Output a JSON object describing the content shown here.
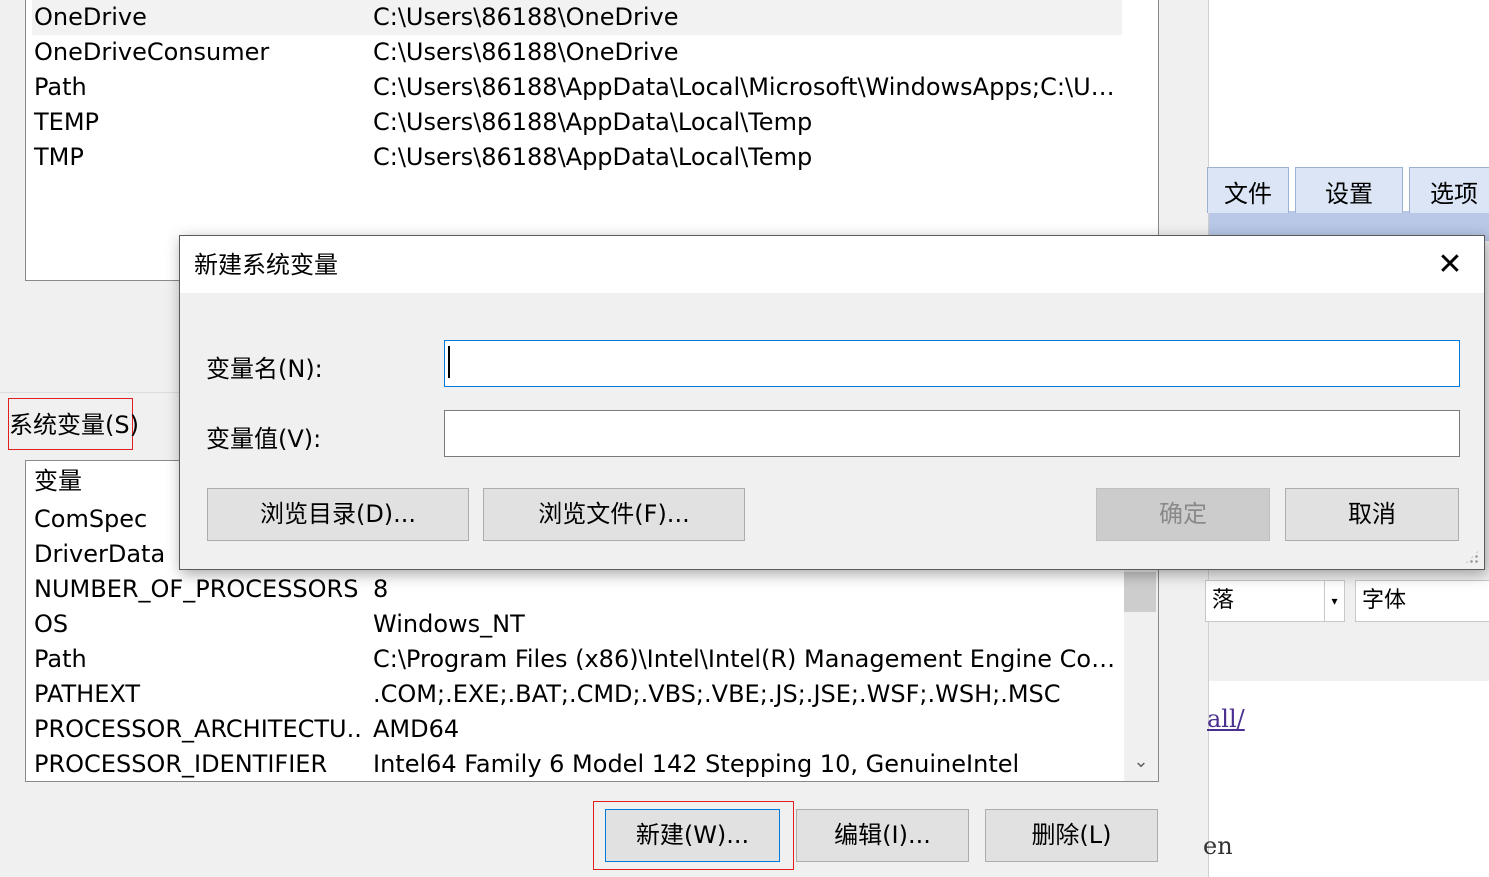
{
  "user_vars": {
    "rows": [
      {
        "name": "OneDrive",
        "value": "C:\\Users\\86188\\OneDrive"
      },
      {
        "name": "OneDriveConsumer",
        "value": "C:\\Users\\86188\\OneDrive"
      },
      {
        "name": "Path",
        "value": "C:\\Users\\86188\\AppData\\Local\\Microsoft\\WindowsApps;C:\\Use..."
      },
      {
        "name": "TEMP",
        "value": "C:\\Users\\86188\\AppData\\Local\\Temp"
      },
      {
        "name": "TMP",
        "value": "C:\\Users\\86188\\AppData\\Local\\Temp"
      }
    ]
  },
  "system_vars": {
    "group_label": "系统变量(S)",
    "column_header": "变量",
    "rows": [
      {
        "name": "ComSpec",
        "value": ""
      },
      {
        "name": "DriverData",
        "value": ""
      },
      {
        "name": "NUMBER_OF_PROCESSORS",
        "value": "8"
      },
      {
        "name": "OS",
        "value": "Windows_NT"
      },
      {
        "name": "Path",
        "value": "C:\\Program Files (x86)\\Intel\\Intel(R) Management Engine Comp..."
      },
      {
        "name": "PATHEXT",
        "value": ".COM;.EXE;.BAT;.CMD;.VBS;.VBE;.JS;.JSE;.WSF;.WSH;.MSC"
      },
      {
        "name": "PROCESSOR_ARCHITECTU...",
        "value": "AMD64"
      },
      {
        "name": "PROCESSOR_IDENTIFIER",
        "value": "Intel64 Family 6 Model 142 Stepping 10, GenuineIntel"
      }
    ],
    "scroll_down_glyph": "⌄",
    "buttons": {
      "new": "新建(W)...",
      "edit": "编辑(I)...",
      "delete": "删除(L)"
    }
  },
  "dialog": {
    "title": "新建系统变量",
    "close_glyph": "✕",
    "name_label": "变量名(N):",
    "name_value": "",
    "value_label": "变量值(V):",
    "value_value": "",
    "buttons": {
      "browse_dir": "浏览目录(D)...",
      "browse_file": "浏览文件(F)...",
      "ok": "确定",
      "cancel": "取消"
    }
  },
  "right_app": {
    "tabs": [
      "文件",
      "设置",
      "选项"
    ],
    "paragraph_combo": "落",
    "combo_arrow": "▾",
    "font_combo": "字体",
    "link_fragment": "all/",
    "text_fragment": "en"
  },
  "colors": {
    "window_bg": "#f0f0f0",
    "highlight_border": "#e02020",
    "focus_blue": "#0078d7",
    "ribbon_blue": "#b8c8e6"
  }
}
